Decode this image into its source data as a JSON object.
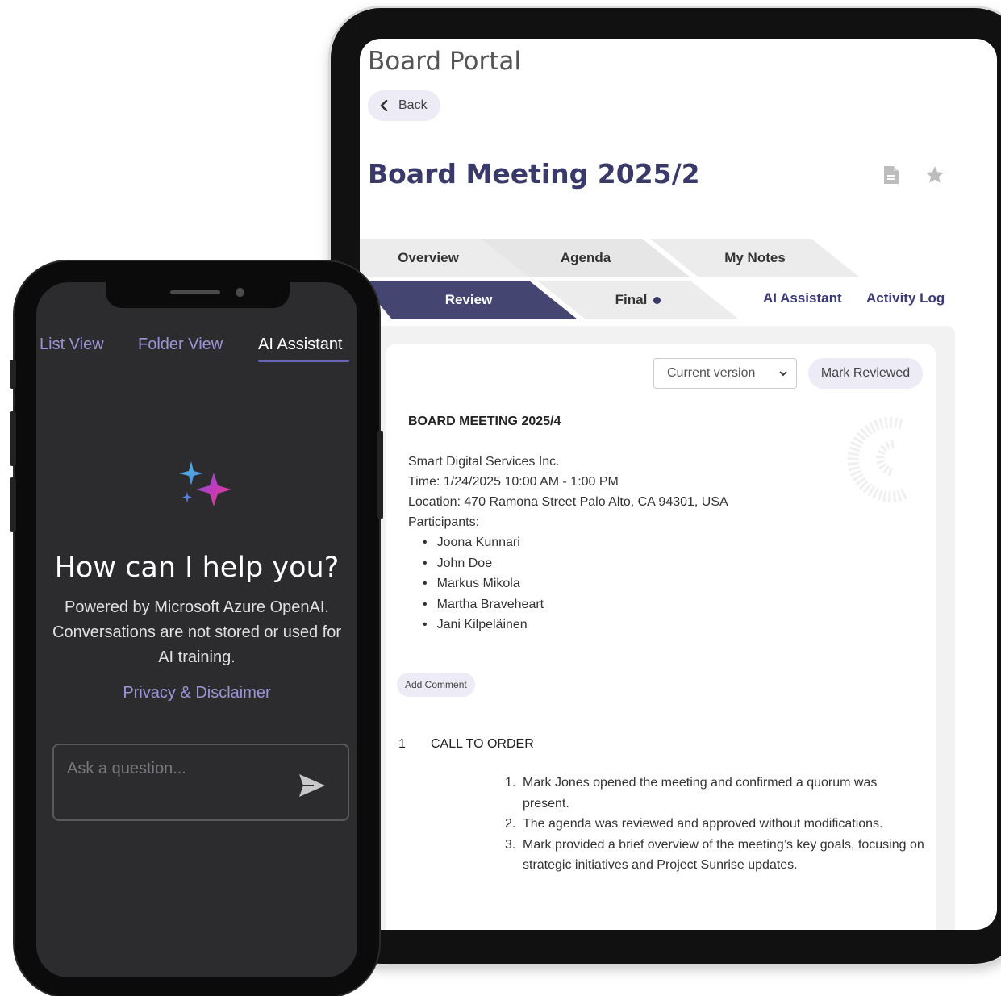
{
  "tablet": {
    "portal_title": "Board Portal",
    "back_label": "Back",
    "meeting_title": "Board Meeting 2025/2",
    "tabs_row1": [
      "Overview",
      "Agenda",
      "My Notes"
    ],
    "tabs_row2": [
      "Review",
      "Final"
    ],
    "link_tabs": [
      "AI Assistant",
      "Activity Log"
    ],
    "version_select": "Current version",
    "mark_reviewed": "Mark Reviewed",
    "document": {
      "heading": "BOARD MEETING 2025/4",
      "company": "Smart Digital Services Inc.",
      "time": "Time: 1/24/2025 10:00 AM - 1:00 PM",
      "location": "Location: 470 Ramona Street  Palo Alto, CA 94301, USA",
      "participants_label": "Participants:",
      "participants": [
        "Joona Kunnari",
        "John Doe",
        "Markus  Mikola",
        "Martha Braveheart",
        "Jani Kilpeläinen"
      ],
      "add_comment": "Add Comment",
      "section_number": "1",
      "section_title": "CALL TO ORDER",
      "minutes": [
        "Mark Jones opened the meeting and confirmed a quorum was present.",
        "The agenda was reviewed and approved without modifications.",
        "Mark provided a brief overview of the meeting’s key goals, focusing on strategic initiatives and Project Sunrise updates."
      ]
    }
  },
  "phone": {
    "tabs": [
      "List View",
      "Folder View",
      "AI Assistant"
    ],
    "active_tab": "AI Assistant",
    "help_title": "How can I help you?",
    "help_subtitle": "Powered by Microsoft Azure OpenAI. Conversations are not stored or used for AI training.",
    "privacy_link": "Privacy & Disclaimer",
    "ask_placeholder": "Ask a question..."
  },
  "colors": {
    "brand_navy": "#454572",
    "accent_lavender": "#9a94d8",
    "pill_bg": "#ecebf6",
    "phone_bg": "#2c2c2e"
  },
  "icons": [
    "chevron-left-icon",
    "document-icon",
    "star-icon",
    "chevron-down-icon",
    "sparkle-icon",
    "send-icon"
  ]
}
